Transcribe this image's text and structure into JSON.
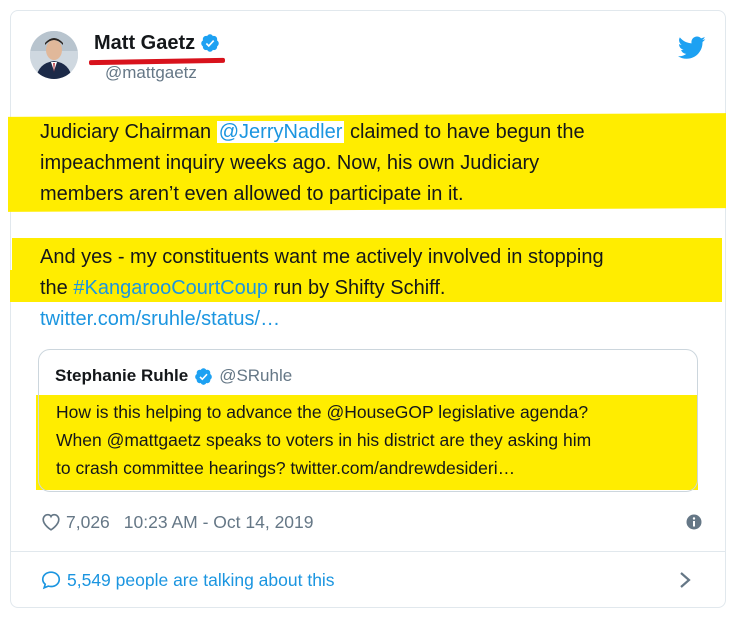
{
  "author": {
    "name": "Matt Gaetz",
    "handle": "@mattgaetz"
  },
  "tweet": {
    "p1_l1_a": "Judiciary Chairman ",
    "p1_l1_mention": "@JerryNadler",
    "p1_l1_b": " claimed to have begun the",
    "p1_l2": "impeachment inquiry weeks ago. Now, his own Judiciary",
    "p1_l3": "members aren’t even allowed to participate in it.",
    "p2_l1": "And yes - my constituents want me actively involved in stopping",
    "p2_l2_a": "the ",
    "p2_l2_hashtag": "#KangarooCourtCoup",
    "p2_l2_b": " run by Shifty Schiff.",
    "p2_l3_link": "twitter.com/sruhle/status/…"
  },
  "quote": {
    "name": "Stephanie Ruhle",
    "handle": "@SRuhle",
    "l1": "How is this helping to advance the @HouseGOP legislative agenda?",
    "l2": "When @mattgaetz speaks to voters in his district are they asking him",
    "l3": "to crash committee hearings? twitter.com/andrewdesideri…"
  },
  "meta": {
    "likes": "7,026",
    "timestamp": "10:23 AM - Oct 14, 2019"
  },
  "footer": {
    "talking": "5,549 people are talking about this"
  },
  "colors": {
    "highlight": "#ffed00",
    "link": "#1b95e0",
    "underline": "#d8121c"
  },
  "icons": [
    "verified-badge-icon",
    "twitter-bird-icon",
    "heart-icon",
    "info-icon",
    "speech-bubble-icon",
    "chevron-right-icon"
  ]
}
